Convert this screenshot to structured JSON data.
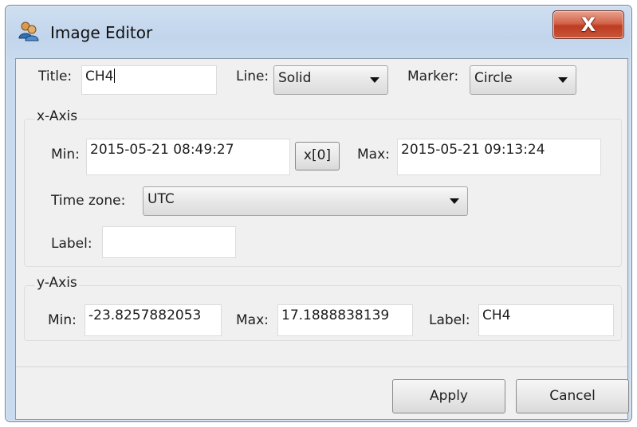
{
  "window": {
    "title": "Image Editor",
    "close_glyph": "X"
  },
  "general": {
    "title_label": "Title:",
    "title_value": "CH4",
    "line_label": "Line:",
    "line_value": "Solid",
    "marker_label": "Marker:",
    "marker_value": "Circle"
  },
  "x_axis": {
    "group_label": "x-Axis",
    "min_label": "Min:",
    "min_value": "2015-05-21 08:49:27",
    "x0_button": "x[0]",
    "max_label": "Max:",
    "max_value": "2015-05-21 09:13:24",
    "timezone_label": "Time zone:",
    "timezone_value": "UTC",
    "label_label": "Label:",
    "label_value": ""
  },
  "y_axis": {
    "group_label": "y-Axis",
    "min_label": "Min:",
    "min_value": "-23.8257882053",
    "max_label": "Max:",
    "max_value": "17.1888838139",
    "label_label": "Label:",
    "label_value": "CH4"
  },
  "buttons": {
    "apply": "Apply",
    "cancel": "Cancel"
  },
  "icons": {
    "app": "users-icon",
    "close": "close-icon",
    "dropdown": "chevron-down-icon"
  },
  "colors": {
    "close_button": "#c9553a",
    "title_bar": "#c2d5ec",
    "client_bg": "#f0f0f0"
  }
}
